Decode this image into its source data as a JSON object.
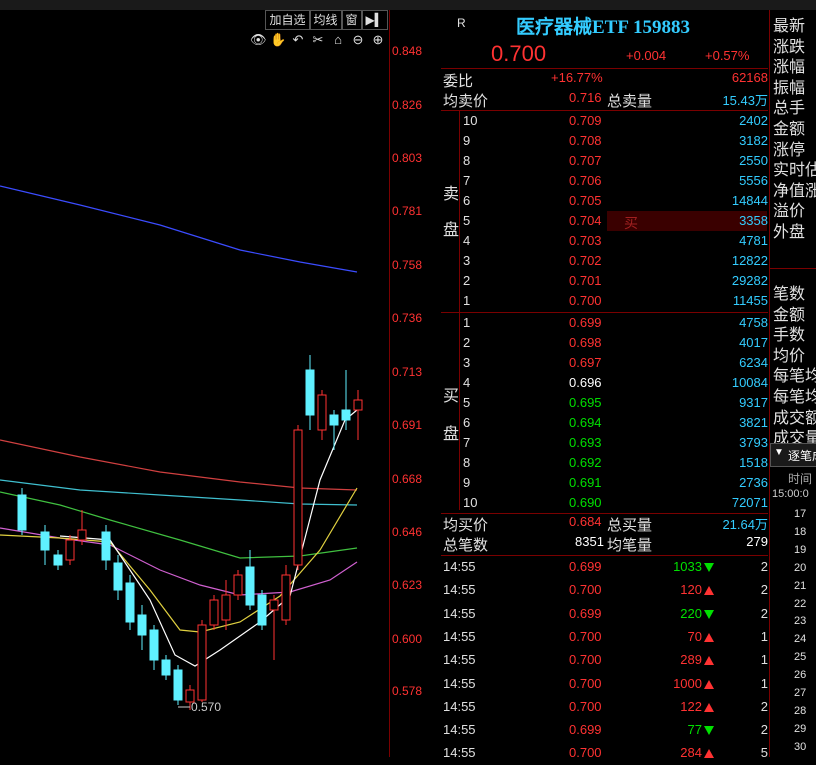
{
  "chart_toolbar": {
    "add_fav": "加自选",
    "ma_line": "均线",
    "window": "窗"
  },
  "y_axis": [
    "0.848",
    "0.826",
    "0.803",
    "0.781",
    "0.758",
    "0.736",
    "0.713",
    "0.691",
    "0.668",
    "0.646",
    "0.623",
    "0.600",
    "0.578"
  ],
  "low_label": "0.570",
  "quote": {
    "r_label": "R",
    "title": "医疗器械ETF 159883",
    "price": "0.700",
    "change": "+0.004",
    "change_pct": "+0.57%",
    "weibi_label": "委比",
    "weibi_value": "+16.77%",
    "weibi_diff": "62168",
    "avg_sell_label": "均卖价",
    "avg_sell_value": "0.716",
    "total_sell_label": "总卖量",
    "total_sell_value": "15.43万",
    "sell_side_label_1": "卖",
    "sell_side_label_2": "盘",
    "buy_side_label_1": "买",
    "buy_side_label_2": "盘",
    "buy_tag": "买",
    "sells": [
      {
        "lvl": "10",
        "price": "0.709",
        "vol": "2402"
      },
      {
        "lvl": "9",
        "price": "0.708",
        "vol": "3182"
      },
      {
        "lvl": "8",
        "price": "0.707",
        "vol": "2550"
      },
      {
        "lvl": "7",
        "price": "0.706",
        "vol": "5556"
      },
      {
        "lvl": "6",
        "price": "0.705",
        "vol": "14844"
      },
      {
        "lvl": "5",
        "price": "0.704",
        "vol": "3358"
      },
      {
        "lvl": "4",
        "price": "0.703",
        "vol": "4781"
      },
      {
        "lvl": "3",
        "price": "0.702",
        "vol": "12822"
      },
      {
        "lvl": "2",
        "price": "0.701",
        "vol": "29282"
      },
      {
        "lvl": "1",
        "price": "0.700",
        "vol": "11455"
      }
    ],
    "buys": [
      {
        "lvl": "1",
        "price": "0.699",
        "vol": "4758",
        "c": "red"
      },
      {
        "lvl": "2",
        "price": "0.698",
        "vol": "4017",
        "c": "red"
      },
      {
        "lvl": "3",
        "price": "0.697",
        "vol": "6234",
        "c": "red"
      },
      {
        "lvl": "4",
        "price": "0.696",
        "vol": "10084",
        "c": "white"
      },
      {
        "lvl": "5",
        "price": "0.695",
        "vol": "9317",
        "c": "green"
      },
      {
        "lvl": "6",
        "price": "0.694",
        "vol": "3821",
        "c": "green"
      },
      {
        "lvl": "7",
        "price": "0.693",
        "vol": "3793",
        "c": "green"
      },
      {
        "lvl": "8",
        "price": "0.692",
        "vol": "1518",
        "c": "green"
      },
      {
        "lvl": "9",
        "price": "0.691",
        "vol": "2736",
        "c": "green"
      },
      {
        "lvl": "10",
        "price": "0.690",
        "vol": "72071",
        "c": "green"
      }
    ],
    "avg_buy_label": "均买价",
    "avg_buy_value": "0.684",
    "total_buy_label": "总买量",
    "total_buy_value": "21.64万",
    "total_trades_label": "总笔数",
    "total_trades_value": "8351",
    "avg_trade_label": "均笔量",
    "avg_trade_value": "279",
    "ticks": [
      {
        "time": "14:55",
        "price": "0.699",
        "pc": "red",
        "vol": "1033",
        "dir": "dn",
        "n": "2"
      },
      {
        "time": "14:55",
        "price": "0.700",
        "pc": "red",
        "vol": "120",
        "dir": "up",
        "n": "2"
      },
      {
        "time": "14:55",
        "price": "0.699",
        "pc": "red",
        "vol": "220",
        "dir": "dn",
        "n": "2"
      },
      {
        "time": "14:55",
        "price": "0.700",
        "pc": "red",
        "vol": "70",
        "dir": "up",
        "n": "1"
      },
      {
        "time": "14:55",
        "price": "0.700",
        "pc": "red",
        "vol": "289",
        "dir": "up",
        "n": "1"
      },
      {
        "time": "14:55",
        "price": "0.700",
        "pc": "red",
        "vol": "1000",
        "dir": "up",
        "n": "1"
      },
      {
        "time": "14:55",
        "price": "0.700",
        "pc": "red",
        "vol": "122",
        "dir": "up",
        "n": "2"
      },
      {
        "time": "14:55",
        "price": "0.699",
        "pc": "red",
        "vol": "77",
        "dir": "dn",
        "n": "2"
      },
      {
        "time": "14:55",
        "price": "0.700",
        "pc": "red",
        "vol": "284",
        "dir": "up",
        "n": "5"
      }
    ]
  },
  "right_panel": {
    "labels_top": [
      "最新",
      "涨跌",
      "涨幅",
      "振幅",
      "总手",
      "金额",
      "涨停",
      "实时估",
      "净值涨",
      "溢价",
      "外盘"
    ],
    "labels_mid": [
      "笔数",
      "金额",
      "手数",
      "均价",
      "每笔均",
      "每笔均",
      "成交额",
      "成交量"
    ],
    "dropdown": "逐笔成",
    "time_header": "时间",
    "time_value": "15:00:0",
    "rows": [
      "17",
      "18",
      "19",
      "20",
      "21",
      "22",
      "23",
      "24",
      "25",
      "26",
      "27",
      "28",
      "29",
      "30"
    ]
  }
}
